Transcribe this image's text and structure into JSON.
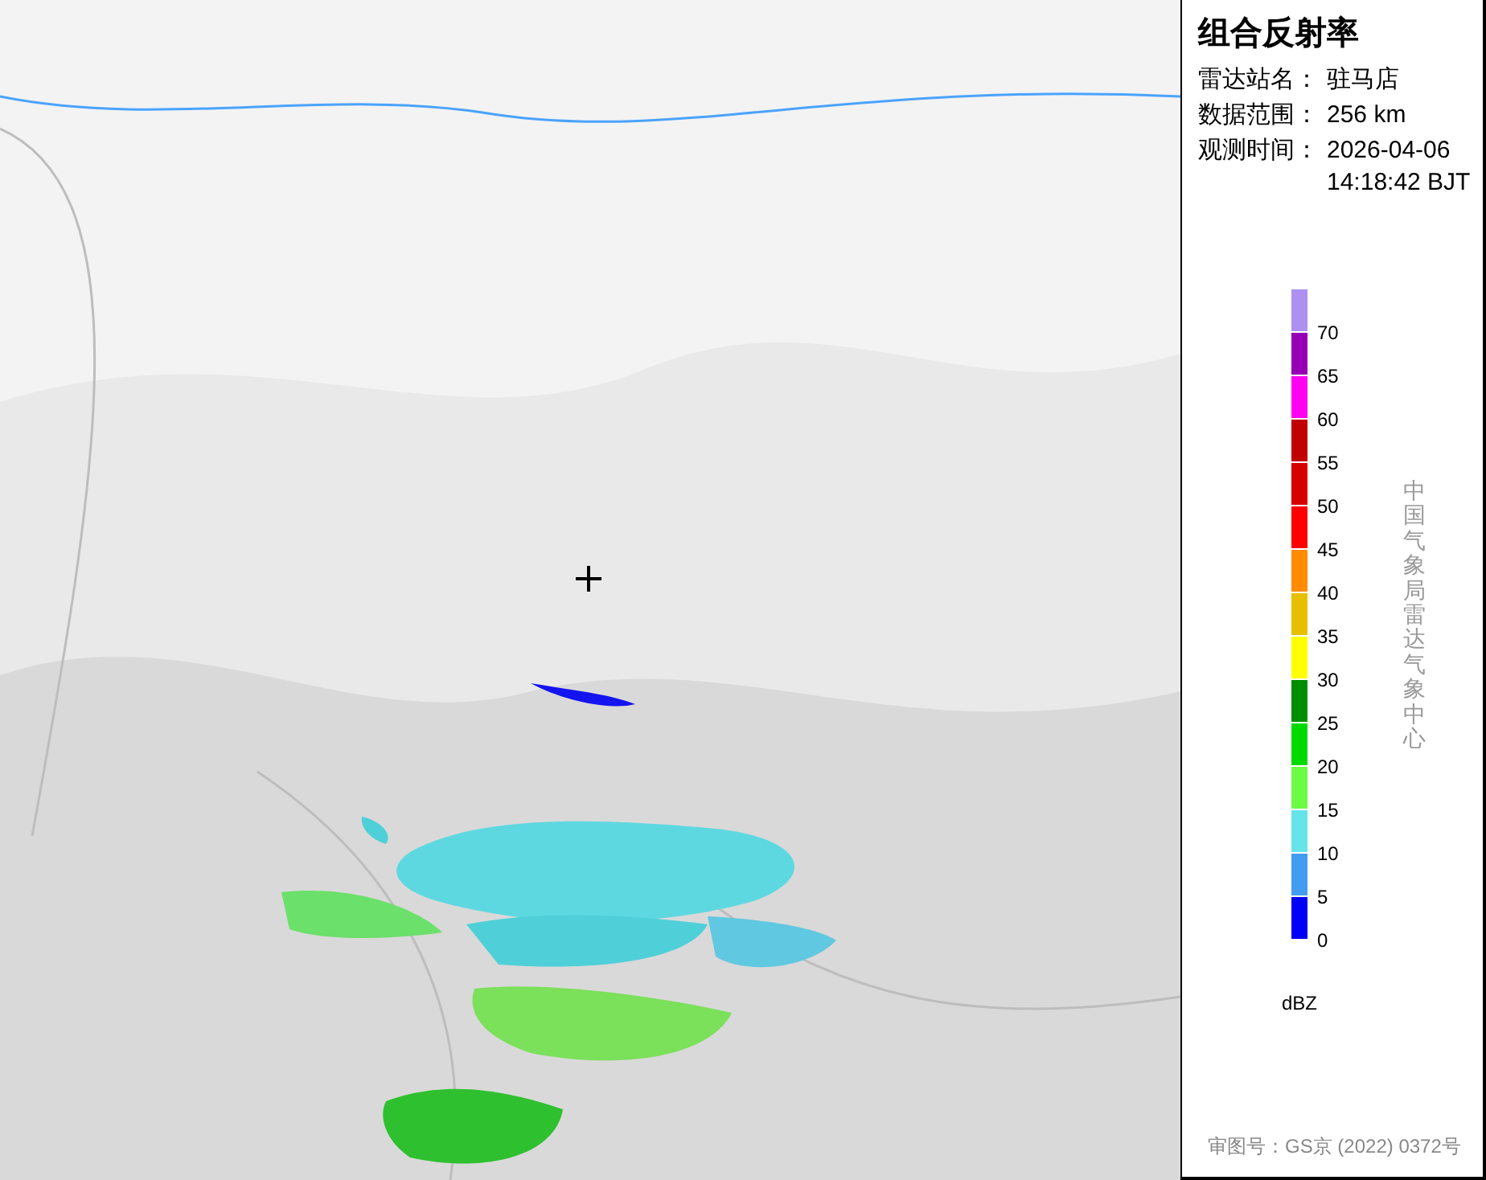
{
  "title": "组合反射率",
  "info": [
    {
      "label": "雷达站名：",
      "value": "驻马店"
    },
    {
      "label": "数据范围：",
      "value": "256 km"
    },
    {
      "label": "观测时间：",
      "value": "2026-04-06 14:18:42 BJT"
    }
  ],
  "legend": {
    "bins": [
      {
        "color": "#ad90f0",
        "label": "70"
      },
      {
        "color": "#9600b4",
        "label": "65"
      },
      {
        "color": "#ff00f0",
        "label": "60"
      },
      {
        "color": "#c10000",
        "label": "55"
      },
      {
        "color": "#d70000",
        "label": "50"
      },
      {
        "color": "#ff0000",
        "label": "45"
      },
      {
        "color": "#ff8c00",
        "label": "40"
      },
      {
        "color": "#e6bf00",
        "label": "35"
      },
      {
        "color": "#ffff00",
        "label": "30"
      },
      {
        "color": "#008d00",
        "label": "25"
      },
      {
        "color": "#00da00",
        "label": "20"
      },
      {
        "color": "#6cfc44",
        "label": "15"
      },
      {
        "color": "#65e5ea",
        "label": "10"
      },
      {
        "color": "#429cf2",
        "label": "5"
      },
      {
        "color": "#0000f6",
        "label": "0"
      }
    ],
    "unit": "dBZ"
  },
  "credit": "中国气象局雷达气象中心",
  "approval": "审图号：GS京 (2022) 0372号"
}
